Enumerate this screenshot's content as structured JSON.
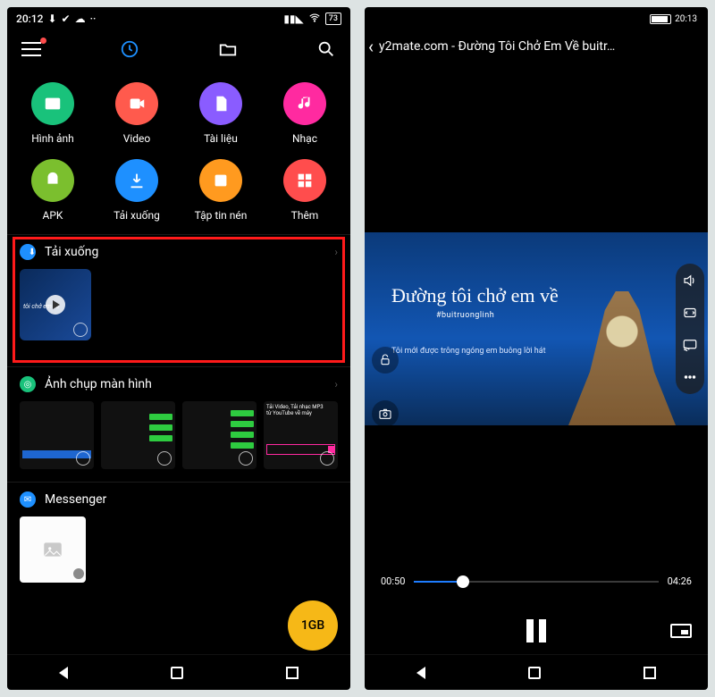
{
  "phone1": {
    "status": {
      "time": "20:12",
      "battery": "73"
    },
    "categories": [
      {
        "label": "Hình ảnh",
        "color": "#19c27b",
        "icon": "image"
      },
      {
        "label": "Video",
        "color": "#ff5a4d",
        "icon": "video"
      },
      {
        "label": "Tài liệu",
        "color": "#8a5cff",
        "icon": "doc"
      },
      {
        "label": "Nhạc",
        "color": "#ff2aa0",
        "icon": "music"
      },
      {
        "label": "APK",
        "color": "#7bbf2e",
        "icon": "apk"
      },
      {
        "label": "Tải xuống",
        "color": "#1e90ff",
        "icon": "download"
      },
      {
        "label": "Tập tin nén",
        "color": "#ff9a1f",
        "icon": "zip"
      },
      {
        "label": "Thêm",
        "color": "#ff4d4d",
        "icon": "more"
      }
    ],
    "sections": {
      "downloads": {
        "title": "Tải xuống",
        "badge_color": "#1e90ff",
        "thumb_text": "tôi chở em về"
      },
      "screenshots": {
        "title": "Ảnh chụp màn hình",
        "badge_color": "#19c27b",
        "thumb4_line1": "Tải Video, Tải nhạc MP3",
        "thumb4_line2": "từ YouTube về máy"
      },
      "messenger": {
        "title": "Messenger",
        "badge_color": "#1e90ff"
      }
    },
    "fab": "1GB"
  },
  "phone2": {
    "status_time": "20:13",
    "title": "y2mate.com - Đường Tôi Chở Em Về  buitr…",
    "video": {
      "line1": "Đường tôi chở em về",
      "line2": "#buitruonglinh",
      "line3": "Tôi mới được trông ngóng em buông lời hát"
    },
    "progress": {
      "current": "00:50",
      "total": "04:26",
      "pct": 20
    }
  }
}
